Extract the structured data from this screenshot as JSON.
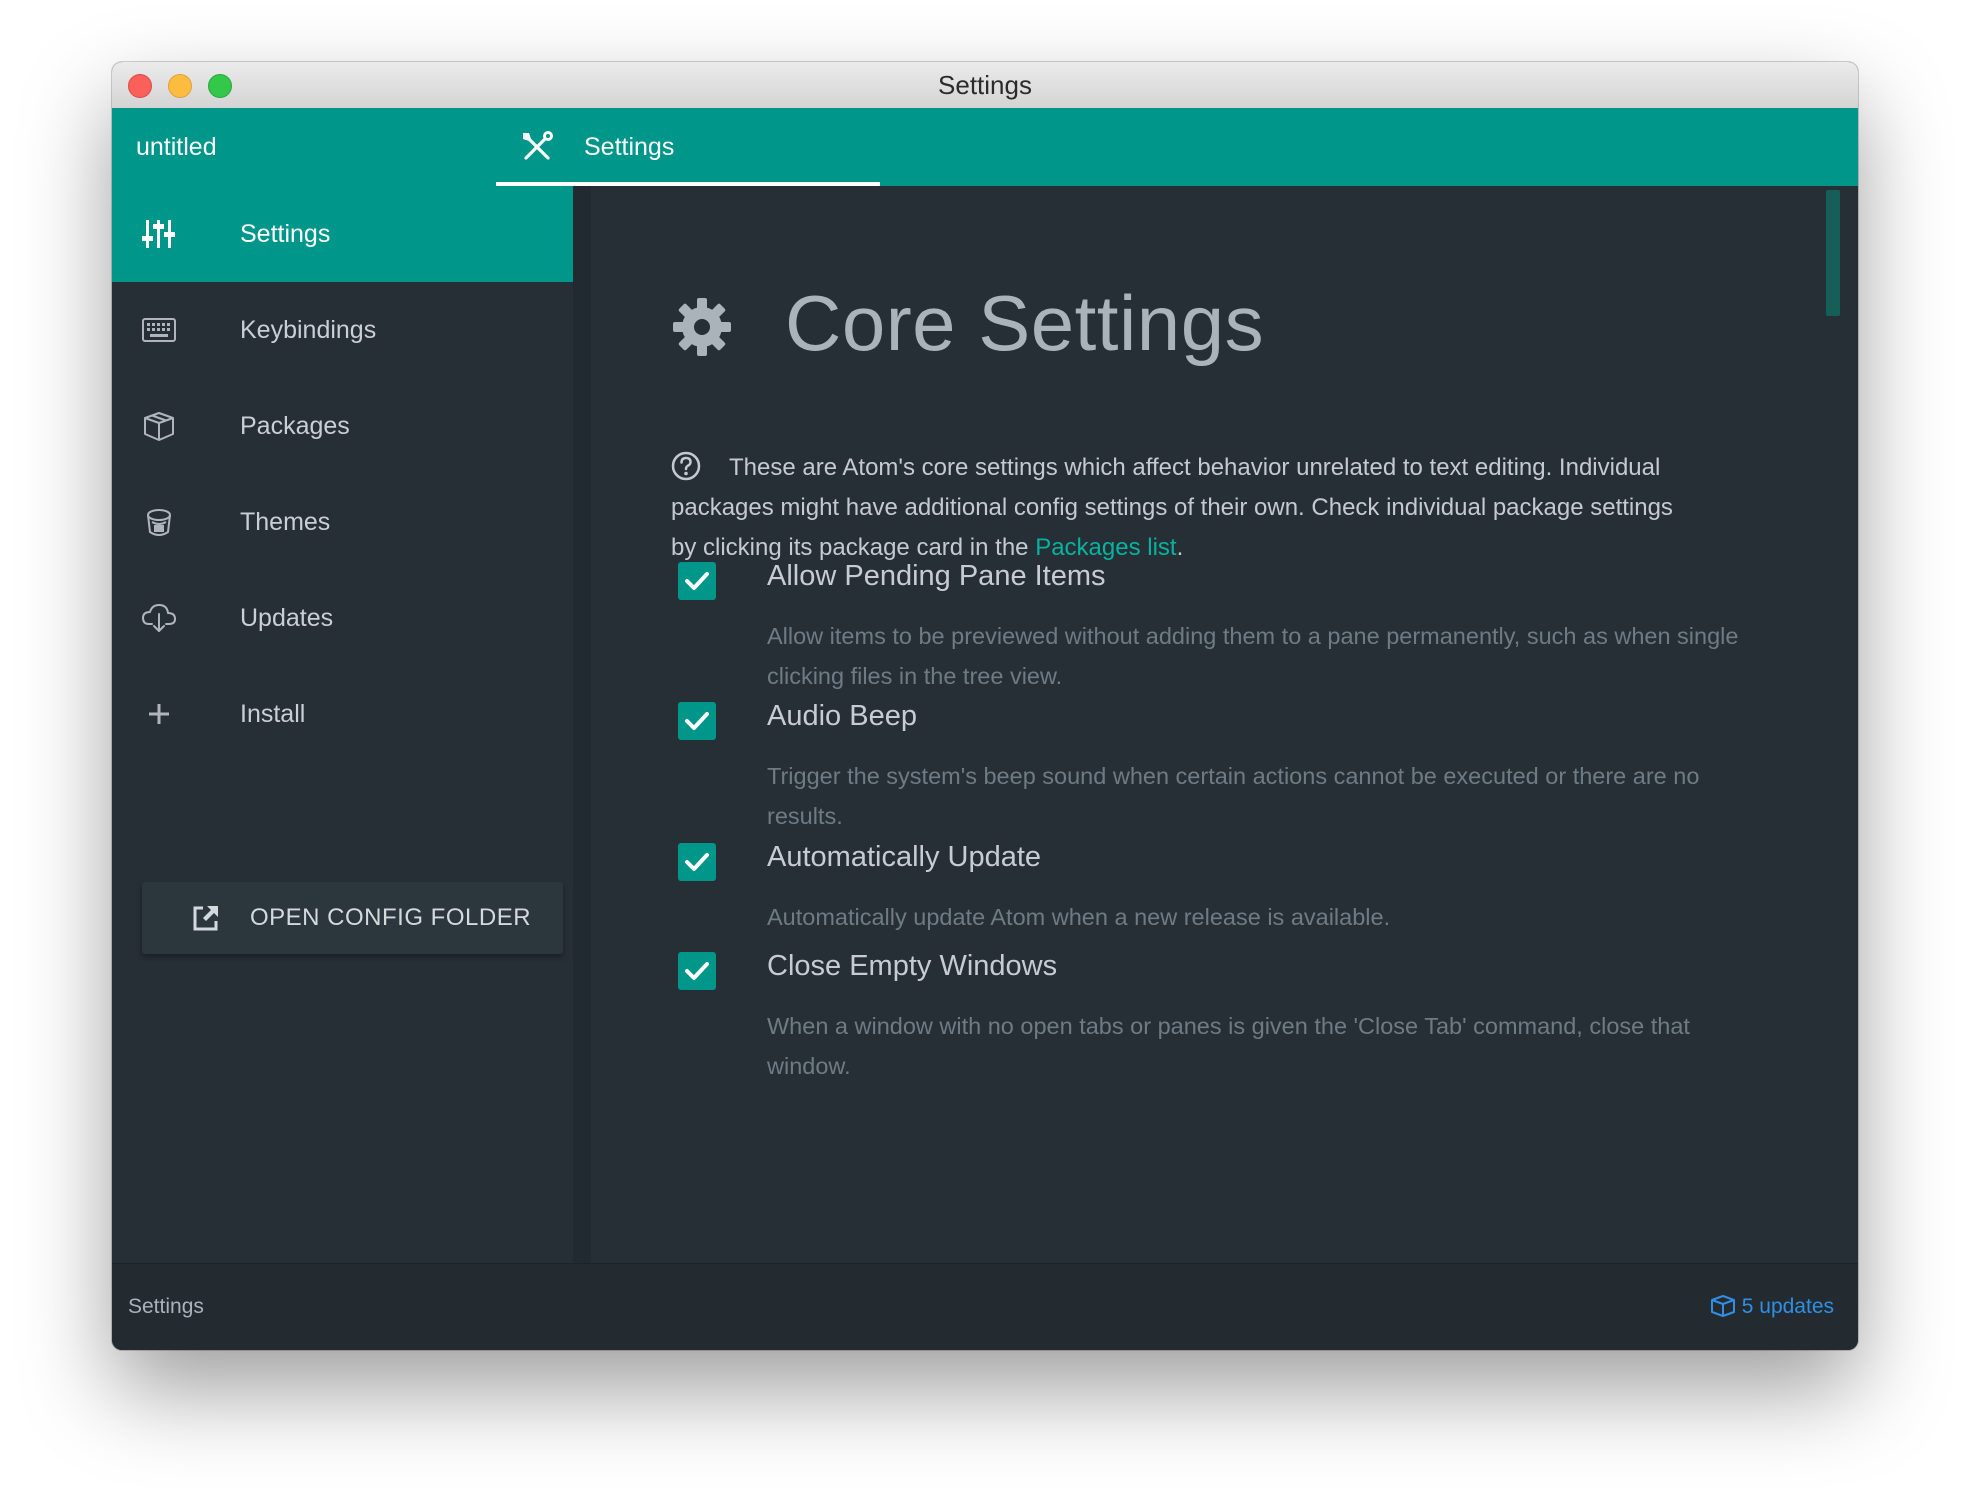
{
  "window": {
    "title": "Settings"
  },
  "tabs": [
    {
      "label": "untitled"
    },
    {
      "label": "Settings"
    }
  ],
  "sidebar": {
    "items": [
      {
        "label": "Settings",
        "icon": "sliders-icon"
      },
      {
        "label": "Keybindings",
        "icon": "keyboard-icon"
      },
      {
        "label": "Packages",
        "icon": "package-icon"
      },
      {
        "label": "Themes",
        "icon": "paintcan-icon"
      },
      {
        "label": "Updates",
        "icon": "cloud-download-icon"
      },
      {
        "label": "Install",
        "icon": "plus-icon"
      }
    ],
    "config_button": "OPEN CONFIG FOLDER"
  },
  "main": {
    "title": "Core Settings",
    "intro_text": "These are Atom's core settings which affect behavior unrelated to text editing. Individual packages might have additional config settings of their own. Check individual package settings by clicking its package card in the ",
    "intro_link": "Packages list",
    "intro_end": ".",
    "settings": [
      {
        "title": "Allow Pending Pane Items",
        "description": "Allow items to be previewed without adding them to a pane permanently, such as when single clicking files in the tree view.",
        "checked": true
      },
      {
        "title": "Audio Beep",
        "description": "Trigger the system's beep sound when certain actions cannot be executed or there are no results.",
        "checked": true
      },
      {
        "title": "Automatically Update",
        "description": "Automatically update Atom when a new release is available.",
        "checked": true
      },
      {
        "title": "Close Empty Windows",
        "description": "When a window with no open tabs or panes is given the 'Close Tab' command, close that window.",
        "checked": true
      }
    ]
  },
  "statusbar": {
    "left": "Settings",
    "updates": "5 updates"
  },
  "colors": {
    "accent": "#00978a",
    "background": "#262f36",
    "link": "#06b39f",
    "status_link": "#2f8fe4"
  }
}
